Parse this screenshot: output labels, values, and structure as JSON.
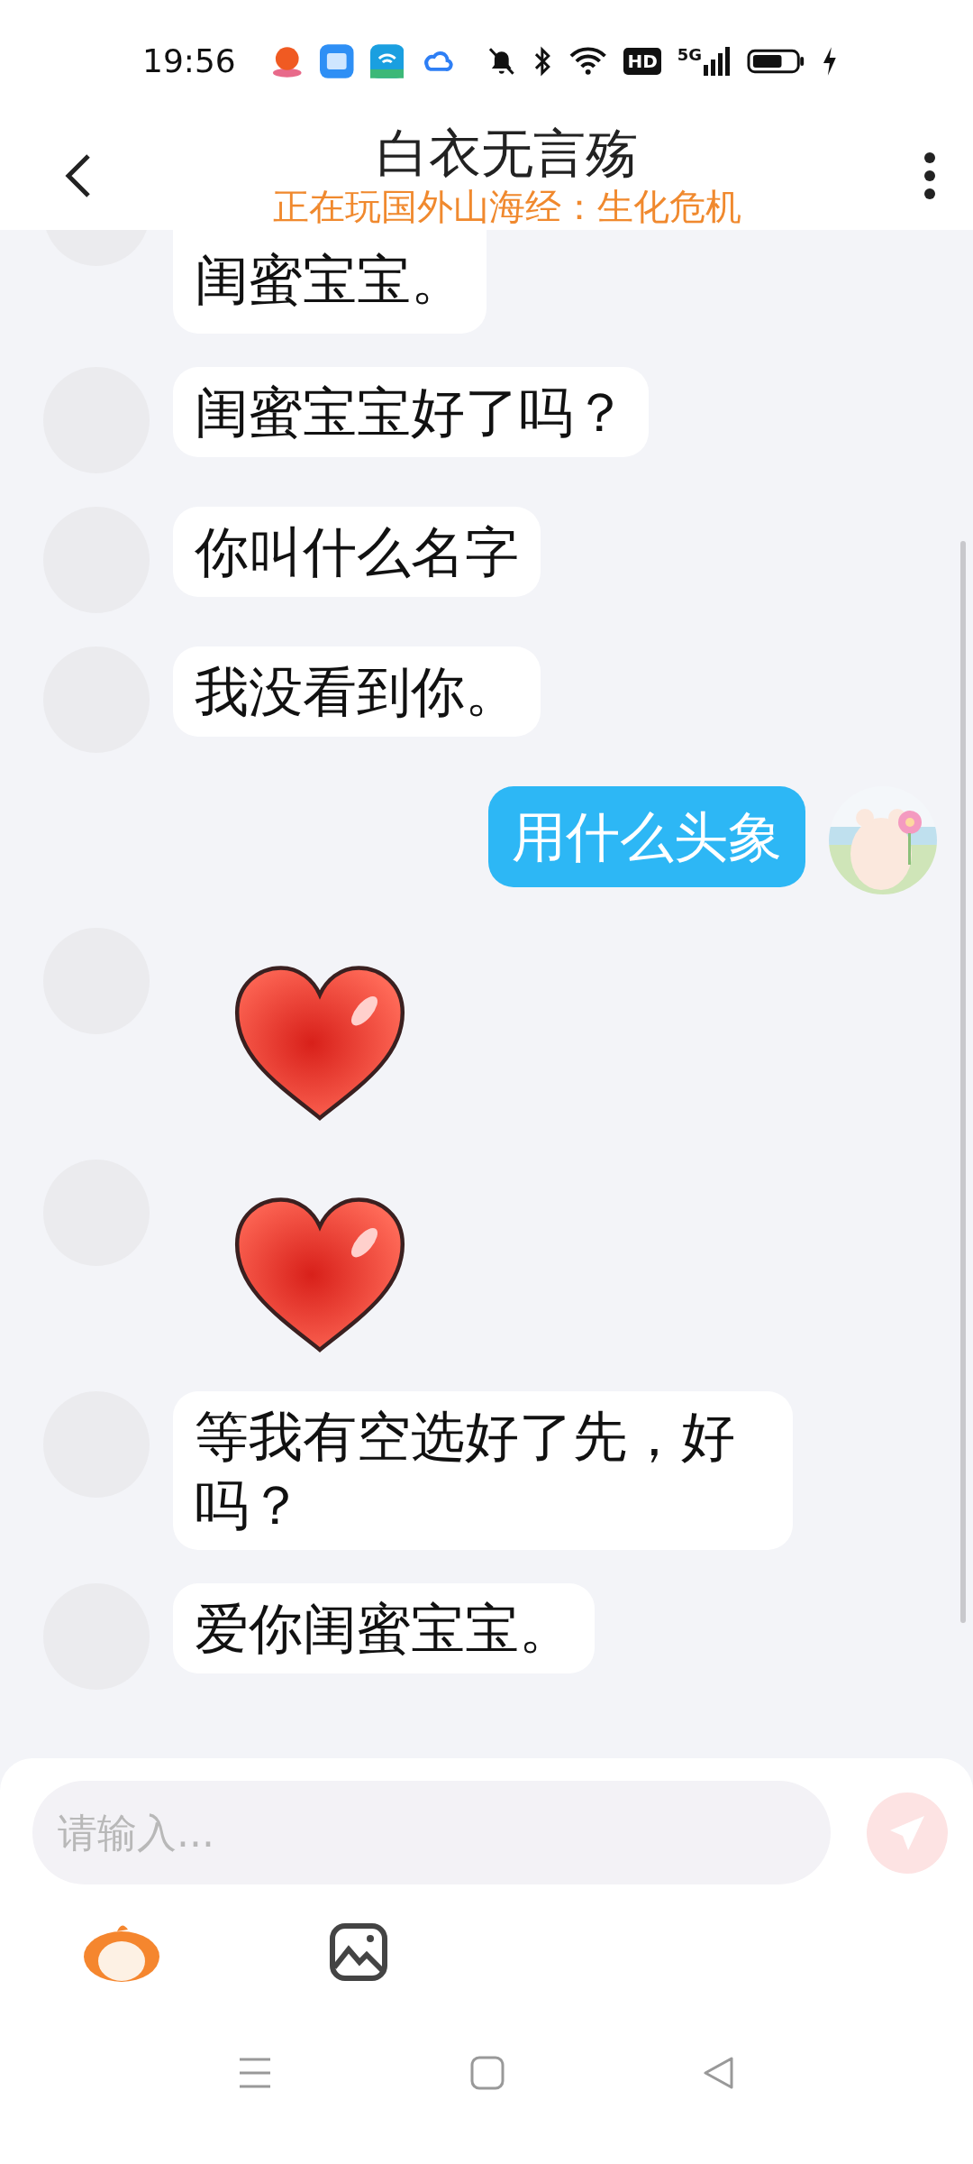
{
  "status_bar": {
    "time": "19:56",
    "hd": "HD",
    "network": "5G"
  },
  "header": {
    "title": "白衣无言殇",
    "subtitle": "正在玩国外山海经：生化危机"
  },
  "messages": [
    {
      "kind": "text",
      "outgoing": false,
      "text": "闺蜜宝宝。"
    },
    {
      "kind": "text",
      "outgoing": false,
      "text": "闺蜜宝宝好了吗？"
    },
    {
      "kind": "text",
      "outgoing": false,
      "text": "你叫什么名字"
    },
    {
      "kind": "text",
      "outgoing": false,
      "text": "我没看到你。"
    },
    {
      "kind": "text",
      "outgoing": true,
      "text": "用什么头象"
    },
    {
      "kind": "sticker",
      "outgoing": false
    },
    {
      "kind": "sticker",
      "outgoing": false
    },
    {
      "kind": "text",
      "outgoing": false,
      "text": "等我有空选好了先，好吗？"
    },
    {
      "kind": "text",
      "outgoing": false,
      "text": "爱你闺蜜宝宝。"
    }
  ],
  "input": {
    "placeholder": "请输入..."
  }
}
